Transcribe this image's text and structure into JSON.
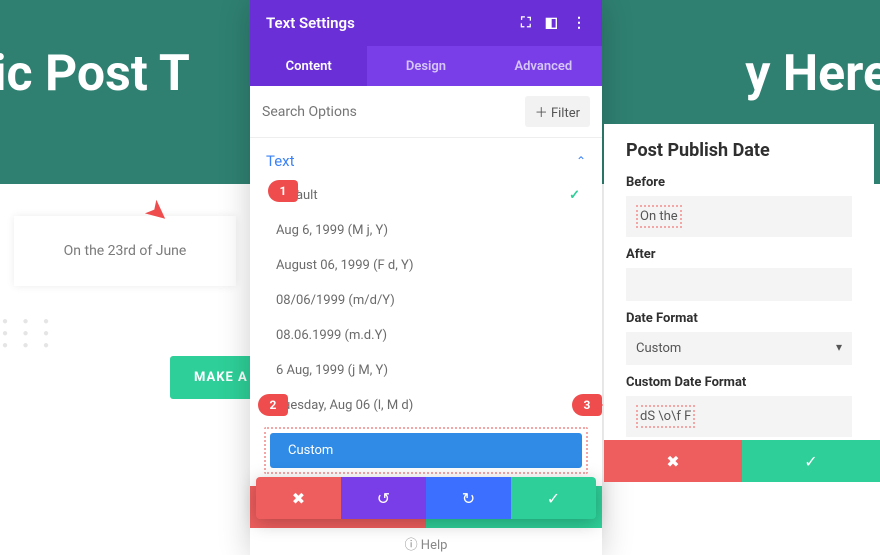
{
  "hero": {
    "left_text": "mic Post T",
    "right_text": "y Here"
  },
  "preview": {
    "text": "On the 23rd of June"
  },
  "cta": {
    "label": "MAKE A"
  },
  "modal": {
    "title": "Text Settings",
    "tabs": {
      "content": "Content",
      "design": "Design",
      "advanced": "Advanced"
    },
    "search_placeholder": "Search Options",
    "filter_label": "Filter",
    "section": "Text",
    "options": {
      "default": "Default",
      "o1": "Aug 6, 1999 (M j, Y)",
      "o2": "August 06, 1999 (F d, Y)",
      "o3": "08/06/1999 (m/d/Y)",
      "o4": "08.06.1999 (m.d.Y)",
      "o5": "6 Aug, 1999 (j M, Y)",
      "o6": "Tuesday, Aug 06 (l, M d)",
      "custom": "Custom"
    },
    "help": "Help"
  },
  "sidepanel": {
    "title": "Post Publish Date",
    "before_label": "Before",
    "before_value": "On the",
    "after_label": "After",
    "after_value": "",
    "date_format_label": "Date Format",
    "date_format_value": "Custom",
    "custom_label": "Custom Date Format",
    "custom_value": "dS \\o\\f F"
  },
  "callouts": {
    "c1": "1",
    "c2": "2",
    "c3": "3"
  }
}
